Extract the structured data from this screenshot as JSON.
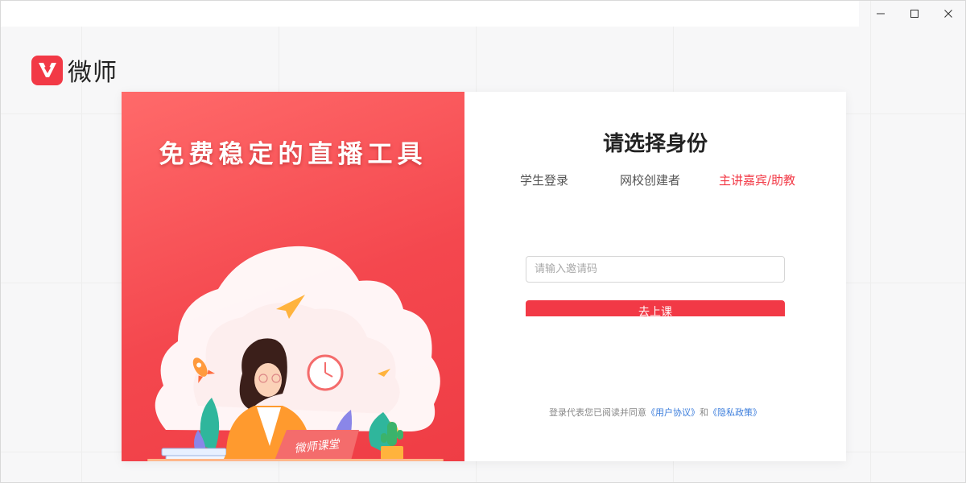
{
  "window": {
    "controls": {
      "minimize": "minimize-icon",
      "maximize": "maximize-icon",
      "close": "close-icon"
    }
  },
  "brand": {
    "name": "微师",
    "accent_color": "#f23946"
  },
  "hero": {
    "title": "免费稳定的直播工具",
    "laptop_text": "微师课堂"
  },
  "login": {
    "title": "请选择身份",
    "tabs": [
      {
        "label": "学生登录",
        "active": false
      },
      {
        "label": "网校创建者",
        "active": false
      },
      {
        "label": "主讲嘉宾/助教",
        "active": true
      }
    ],
    "invite_code": {
      "placeholder": "请输入邀请码",
      "value": ""
    },
    "submit_label": "去上课",
    "agreement": {
      "prefix": "登录代表您已阅读并同意",
      "user_agreement": "《用户协议》",
      "and": "和",
      "privacy_policy": "《隐私政策》"
    }
  }
}
